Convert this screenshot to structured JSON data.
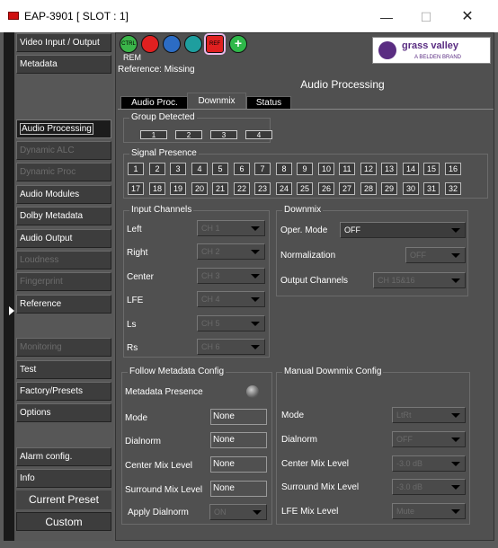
{
  "window": {
    "title": "EAP-3901 [ SLOT : 1]",
    "minimize": "—",
    "maximize": "☐",
    "close": "✕"
  },
  "sidebar": {
    "items": [
      {
        "label": "Video Input / Output",
        "state": "enabled"
      },
      {
        "label": "Metadata",
        "state": "enabled"
      },
      {
        "label": "Audio Processing",
        "state": "active"
      },
      {
        "label": "Dynamic ALC",
        "state": "disabled"
      },
      {
        "label": "Dynamic Proc",
        "state": "disabled"
      },
      {
        "label": "Audio Modules",
        "state": "enabled"
      },
      {
        "label": "Dolby Metadata",
        "state": "enabled"
      },
      {
        "label": "Audio Output",
        "state": "enabled"
      },
      {
        "label": "Loudness",
        "state": "disabled"
      },
      {
        "label": "Fingerprint",
        "state": "disabled"
      },
      {
        "label": "Reference",
        "state": "enabled"
      },
      {
        "label": "Monitoring",
        "state": "disabled"
      },
      {
        "label": "Test",
        "state": "enabled"
      },
      {
        "label": "Factory/Presets",
        "state": "enabled"
      },
      {
        "label": "Options",
        "state": "enabled"
      },
      {
        "label": "Alarm config.",
        "state": "enabled"
      },
      {
        "label": "Info",
        "state": "enabled"
      }
    ],
    "current_preset_label": "Current Preset",
    "current_preset_value": "Custom"
  },
  "toolbar": {
    "ctrl": "CTRL",
    "rem": "REM",
    "ref": "REF"
  },
  "logo": {
    "name": "grass valley",
    "sub": "A BELDEN BRAND"
  },
  "status": {
    "reference": "Reference: Missing"
  },
  "page_title": "Audio Processing",
  "tabs": [
    "Audio Proc.",
    "Downmix",
    "Status"
  ],
  "active_tab": "Downmix",
  "group_detected": {
    "title": "Group Detected",
    "groups": [
      "1",
      "2",
      "3",
      "4"
    ]
  },
  "signal_presence": {
    "title": "Signal Presence",
    "channels": [
      "1",
      "2",
      "3",
      "4",
      "5",
      "6",
      "7",
      "8",
      "9",
      "10",
      "11",
      "12",
      "13",
      "14",
      "15",
      "16",
      "17",
      "18",
      "19",
      "20",
      "21",
      "22",
      "23",
      "24",
      "25",
      "26",
      "27",
      "28",
      "29",
      "30",
      "31",
      "32"
    ]
  },
  "input_channels": {
    "title": "Input Channels",
    "rows": [
      {
        "label": "Left",
        "value": "CH 1"
      },
      {
        "label": "Right",
        "value": "CH 2"
      },
      {
        "label": "Center",
        "value": "CH 3"
      },
      {
        "label": "LFE",
        "value": "CH 4"
      },
      {
        "label": "Ls",
        "value": "CH 5"
      },
      {
        "label": "Rs",
        "value": "CH 6"
      }
    ]
  },
  "downmix": {
    "title": "Downmix",
    "oper_mode_label": "Oper. Mode",
    "oper_mode_value": "OFF",
    "normalization_label": "Normalization",
    "normalization_value": "OFF",
    "output_channels_label": "Output Channels",
    "output_channels_value": "CH 15&16"
  },
  "follow_metadata": {
    "title": "Follow Metadata Config",
    "presence_label": "Metadata Presence",
    "mode_label": "Mode",
    "mode_value": "None",
    "dialnorm_label": "Dialnorm",
    "dialnorm_value": "None",
    "center_mix_label": "Center Mix Level",
    "center_mix_value": "None",
    "surround_mix_label": "Surround Mix Level",
    "surround_mix_value": "None",
    "apply_dialnorm_label": "Apply Dialnorm",
    "apply_dialnorm_value": "ON"
  },
  "manual_downmix": {
    "title": "Manual Downmix Config",
    "mode_label": "Mode",
    "mode_value": "LtRt",
    "dialnorm_label": "Dialnorm",
    "dialnorm_value": "OFF",
    "center_mix_label": "Center Mix Level",
    "center_mix_value": "-3.0 dB",
    "surround_mix_label": "Surround Mix Level",
    "surround_mix_value": "-3.0 dB",
    "lfe_mix_label": "LFE Mix Level",
    "lfe_mix_value": "Mute"
  }
}
